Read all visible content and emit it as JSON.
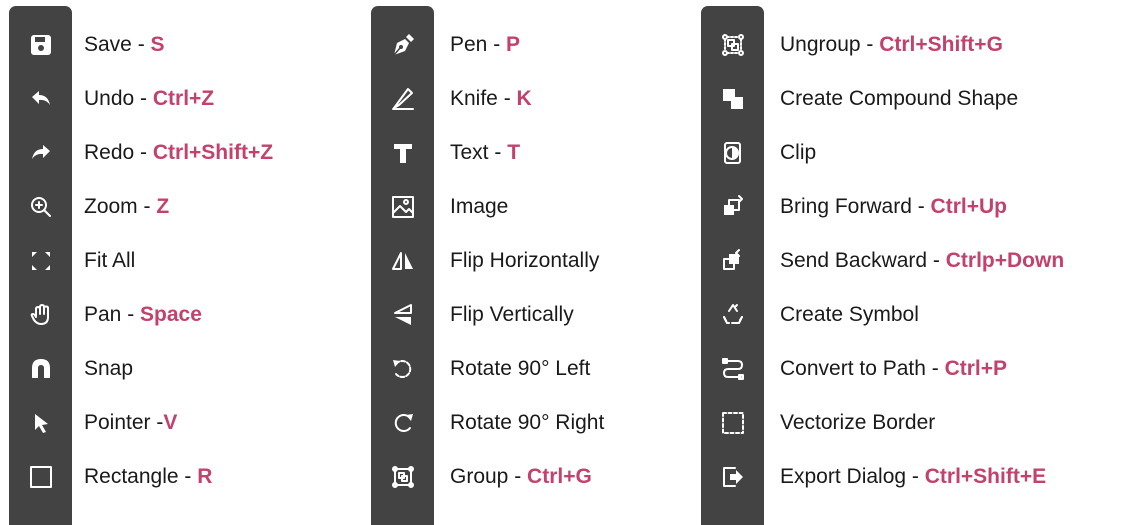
{
  "columns": [
    {
      "items": [
        {
          "name": "save",
          "icon": "floppy-disk-icon",
          "label": "Save - ",
          "key": "S"
        },
        {
          "name": "undo",
          "icon": "undo-arrow-icon",
          "label": "Undo - ",
          "key": "Ctrl+Z"
        },
        {
          "name": "redo",
          "icon": "redo-arrow-icon",
          "label": "Redo - ",
          "key": "Ctrl+Shift+Z"
        },
        {
          "name": "zoom",
          "icon": "zoom-in-icon",
          "label": "Zoom - ",
          "key": "Z"
        },
        {
          "name": "fit-all",
          "icon": "fit-all-icon",
          "label": "Fit All",
          "key": ""
        },
        {
          "name": "pan",
          "icon": "hand-icon",
          "label": "Pan - ",
          "key": "Space"
        },
        {
          "name": "snap",
          "icon": "magnet-icon",
          "label": "Snap",
          "key": ""
        },
        {
          "name": "pointer",
          "icon": "pointer-arrow-icon",
          "label": "Pointer -",
          "key": "V"
        },
        {
          "name": "rectangle",
          "icon": "rectangle-icon",
          "label": "Rectangle - ",
          "key": "R"
        }
      ]
    },
    {
      "items": [
        {
          "name": "pen",
          "icon": "pen-nib-icon",
          "label": "Pen - ",
          "key": "P"
        },
        {
          "name": "knife",
          "icon": "knife-icon",
          "label": "Knife - ",
          "key": "K"
        },
        {
          "name": "text",
          "icon": "text-t-icon",
          "label": "Text - ",
          "key": "T"
        },
        {
          "name": "image",
          "icon": "image-icon",
          "label": "Image",
          "key": ""
        },
        {
          "name": "flip-horizontally",
          "icon": "flip-horizontal-icon",
          "label": "Flip Horizontally",
          "key": ""
        },
        {
          "name": "flip-vertically",
          "icon": "flip-vertical-icon",
          "label": "Flip Vertically",
          "key": ""
        },
        {
          "name": "rotate-left",
          "icon": "rotate-left-icon",
          "label": "Rotate 90° Left",
          "key": ""
        },
        {
          "name": "rotate-right",
          "icon": "rotate-right-icon",
          "label": "Rotate 90° Right",
          "key": ""
        },
        {
          "name": "group",
          "icon": "group-icon",
          "label": "Group - ",
          "key": "Ctrl+G"
        }
      ]
    },
    {
      "items": [
        {
          "name": "ungroup",
          "icon": "ungroup-icon",
          "label": "Ungroup - ",
          "key": "Ctrl+Shift+G"
        },
        {
          "name": "create-compound-shape",
          "icon": "compound-shape-icon",
          "label": "Create Compound Shape",
          "key": ""
        },
        {
          "name": "clip",
          "icon": "clip-icon",
          "label": "Clip",
          "key": ""
        },
        {
          "name": "bring-forward",
          "icon": "bring-forward-icon",
          "label": "Bring Forward - ",
          "key": "Ctrl+Up"
        },
        {
          "name": "send-backward",
          "icon": "send-backward-icon",
          "label": "Send Backward - ",
          "key": "Ctrlp+Down"
        },
        {
          "name": "create-symbol",
          "icon": "symbol-recycle-icon",
          "label": "Create Symbol",
          "key": ""
        },
        {
          "name": "convert-to-path",
          "icon": "path-icon",
          "label": "Convert to Path - ",
          "key": "Ctrl+P"
        },
        {
          "name": "vectorize-border",
          "icon": "dashed-border-icon",
          "label": "Vectorize Border",
          "key": ""
        },
        {
          "name": "export-dialog",
          "icon": "export-icon",
          "label": "Export Dialog - ",
          "key": "Ctrl+Shift+E"
        }
      ]
    }
  ],
  "colors": {
    "strip": "#434343",
    "icon": "#ffffff",
    "text": "#1a1a1a",
    "key": "#c2416d"
  }
}
